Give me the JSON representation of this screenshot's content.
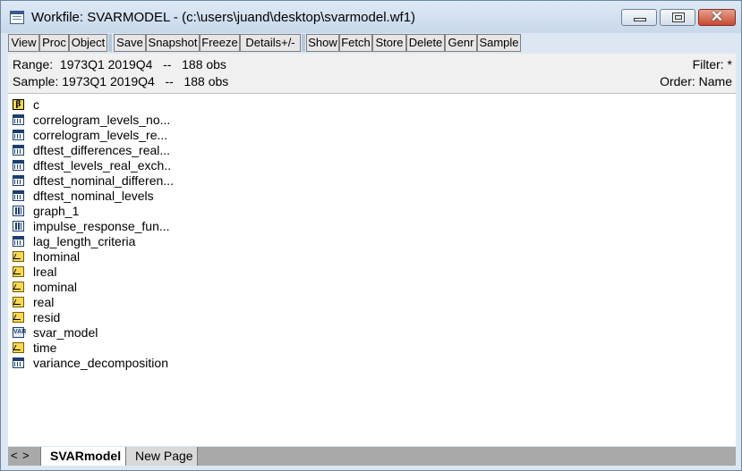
{
  "window": {
    "title": "Workfile: SVARMODEL - (c:\\users\\juand\\desktop\\svarmodel.wf1)",
    "close_glyph": "✕"
  },
  "toolbar": {
    "view": "View",
    "proc": "Proc",
    "object": "Object",
    "save": "Save",
    "snapshot": "Snapshot",
    "freeze": "Freeze",
    "details": "Details+/-",
    "show": "Show",
    "fetch": "Fetch",
    "store": "Store",
    "delete": "Delete",
    "genr": "Genr",
    "sample": "Sample"
  },
  "info": {
    "range": "Range:  1973Q1 2019Q4   --   188 obs",
    "sample": "Sample: 1973Q1 2019Q4   --   188 obs",
    "filter": "Filter: *",
    "order": "Order: Name"
  },
  "objects": [
    {
      "name": "c",
      "icon": "coef-icon"
    },
    {
      "name": "correlogram_levels_no...",
      "icon": "table-icon"
    },
    {
      "name": "correlogram_levels_re...",
      "icon": "table-icon"
    },
    {
      "name": "dftest_differences_real...",
      "icon": "table-icon"
    },
    {
      "name": "dftest_levels_real_exch..",
      "icon": "table-icon"
    },
    {
      "name": "dftest_nominal_differen...",
      "icon": "table-icon"
    },
    {
      "name": "dftest_nominal_levels",
      "icon": "table-icon"
    },
    {
      "name": "graph_1",
      "icon": "graph-icon"
    },
    {
      "name": "impulse_response_fun...",
      "icon": "graph-icon"
    },
    {
      "name": "lag_length_criteria",
      "icon": "table-icon"
    },
    {
      "name": "lnominal",
      "icon": "series-icon"
    },
    {
      "name": "lreal",
      "icon": "series-icon"
    },
    {
      "name": "nominal",
      "icon": "series-icon"
    },
    {
      "name": "real",
      "icon": "series-icon"
    },
    {
      "name": "resid",
      "icon": "series-icon"
    },
    {
      "name": "svar_model",
      "icon": "var-icon"
    },
    {
      "name": "time",
      "icon": "series-icon"
    },
    {
      "name": "variance_decomposition",
      "icon": "table-icon"
    }
  ],
  "coef_icon_glyph": "β",
  "var_icon_glyph": "VAR",
  "tabs": {
    "prev": "<",
    "next": ">",
    "active": "SVARmodel",
    "new_page": "New Page"
  }
}
